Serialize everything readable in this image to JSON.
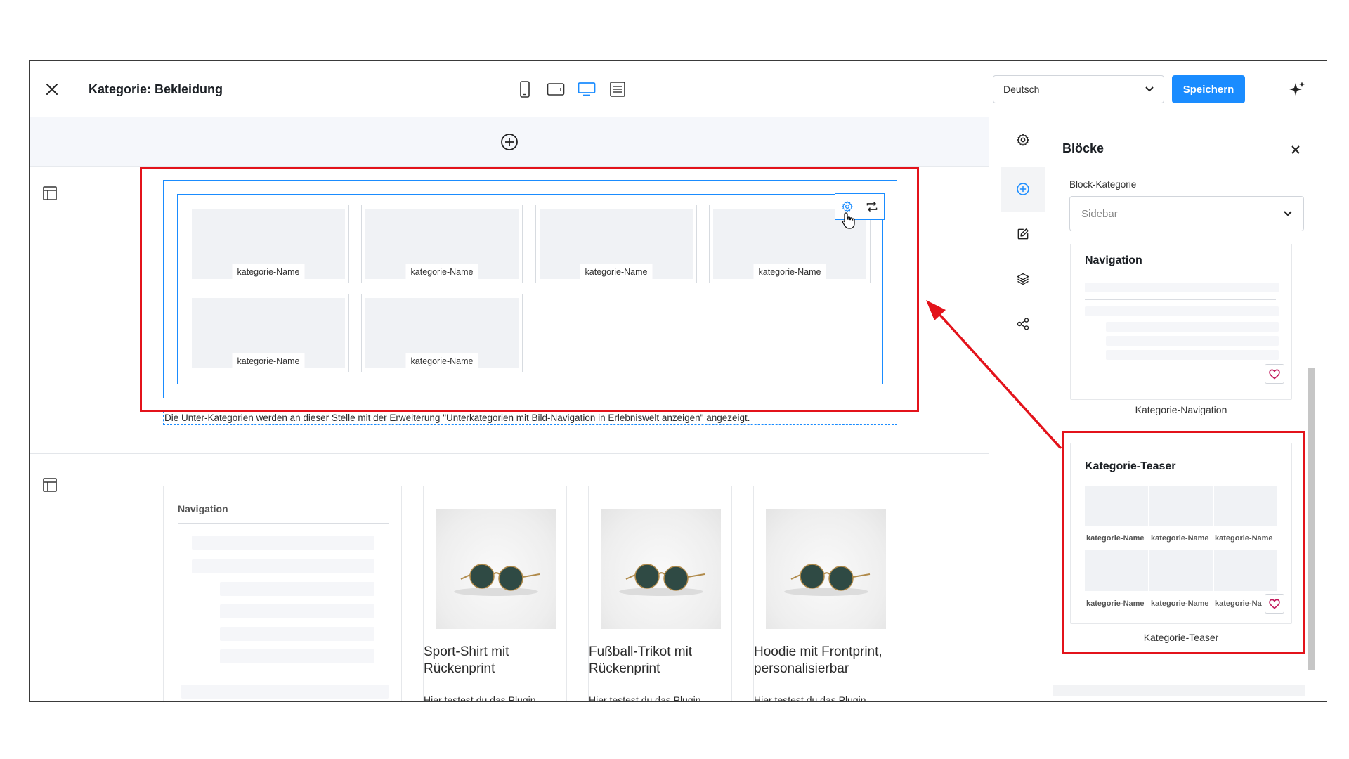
{
  "header": {
    "title": "Kategorie: Bekleidung",
    "language": "Deutsch",
    "save_label": "Speichern"
  },
  "devices": [
    "mobile-icon",
    "tablet-icon",
    "desktop-icon",
    "form-icon"
  ],
  "canvas": {
    "category_tile_label": "kategorie-Name",
    "tiles": [
      "kategorie-Name",
      "kategorie-Name",
      "kategorie-Name",
      "kategorie-Name",
      "kategorie-Name",
      "kategorie-Name"
    ],
    "info_text": "Die Unter-Kategorien werden an dieser Stelle mit der Erweiterung \"Unterkategorien mit Bild-Navigation in Erlebniswelt anzeigen\" angezeigt.",
    "nav_title": "Navigation",
    "products": [
      {
        "name": "Sport-Shirt mit Rückenprint",
        "desc": "Hier testest du das Plugin"
      },
      {
        "name": "Fußball-Trikot mit Rückenprint",
        "desc": "Hier testest du das Plugin"
      },
      {
        "name": "Hoodie mit Frontprint, personalisierbar",
        "desc": "Hier testest du das Plugin"
      }
    ]
  },
  "rail": [
    "settings-icon",
    "add-block-icon",
    "edit-icon",
    "layers-icon",
    "share-icon"
  ],
  "panel": {
    "title": "Blöcke",
    "category_label": "Block-Kategorie",
    "category_value": "Sidebar",
    "blocks": [
      {
        "title": "Navigation",
        "caption": "Kategorie-Navigation"
      },
      {
        "title": "Kategorie-Teaser",
        "caption": "Kategorie-Teaser",
        "labels": [
          "kategorie-Name",
          "kategorie-Name",
          "kategorie-Name",
          "kategorie-Name",
          "kategorie-Name",
          "kategorie-Na"
        ]
      }
    ]
  },
  "colors": {
    "accent": "#1a8cff",
    "highlight": "#e3131b",
    "favorite": "#c2185b"
  }
}
